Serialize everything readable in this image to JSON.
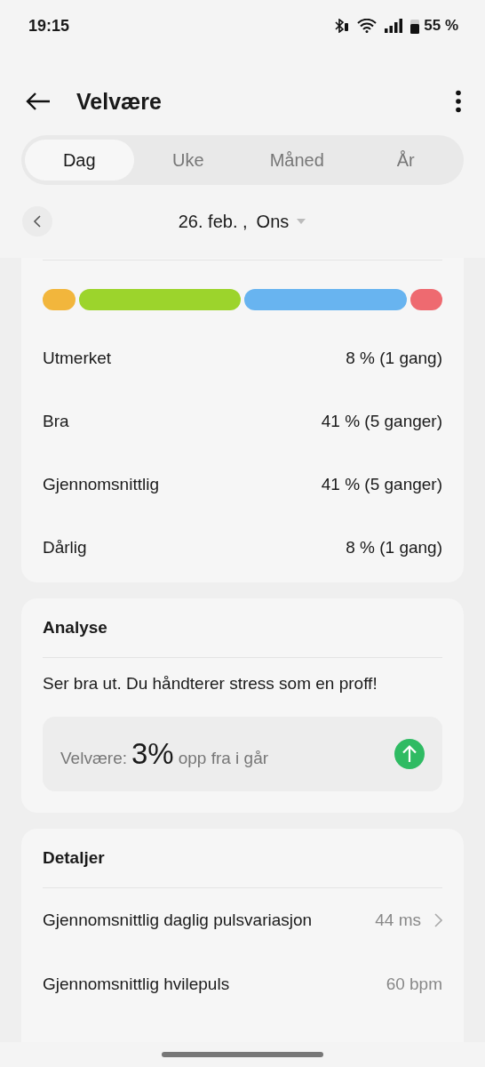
{
  "status_bar": {
    "time": "19:15",
    "battery": "55 %"
  },
  "header": {
    "title": "Velvære"
  },
  "tabs": [
    {
      "label": "Dag",
      "selected": true
    },
    {
      "label": "Uke",
      "selected": false
    },
    {
      "label": "Måned",
      "selected": false
    },
    {
      "label": "År",
      "selected": false
    }
  ],
  "date_picker": {
    "date": "26. feb. ,",
    "weekday": "Ons"
  },
  "distribution": [
    {
      "label": "Utmerket",
      "value": "8 % (1 gang)",
      "color": "#f2b63c"
    },
    {
      "label": "Bra",
      "value": "41 % (5 ganger)",
      "color": "#9cd42c"
    },
    {
      "label": "Gjennomsnittlig",
      "value": "41 % (5 ganger)",
      "color": "#68b4f0"
    },
    {
      "label": "Dårlig",
      "value": "8 % (1 gang)",
      "color": "#ee6a70"
    }
  ],
  "analysis": {
    "title": "Analyse",
    "text": "Ser bra ut. Du håndterer stress som en proff!",
    "delta_label": "Velvære:",
    "delta_value": "3%",
    "delta_text": "opp fra i går"
  },
  "details": {
    "title": "Detaljer",
    "rows": [
      {
        "label": "Gjennomsnittlig daglig pulsvariasjon",
        "value": "44 ms",
        "has_link": true
      },
      {
        "label": "Gjennomsnittlig hvilepuls",
        "value": "60 bpm",
        "has_link": false
      }
    ]
  }
}
